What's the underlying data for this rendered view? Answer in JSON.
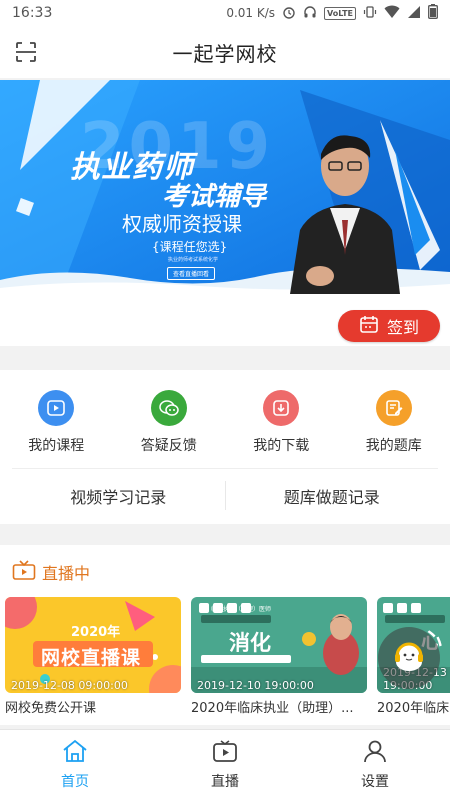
{
  "status_bar": {
    "time": "16:33",
    "speed": "0.01 K/s",
    "network_badge": "VoLTE"
  },
  "header": {
    "title": "一起学网校",
    "scan_icon": "scan-icon"
  },
  "banner": {
    "year": "2019",
    "line1": "执业药师",
    "line2": "考试辅导",
    "line3": "权威师资授课",
    "line4": "{课程任您选}",
    "line5": "执业药师考试系统化学",
    "line6": "查看直播回看"
  },
  "checkin": {
    "label": "签到",
    "color": "#e53a2e"
  },
  "quick_menu": {
    "items": [
      {
        "label": "我的课程",
        "icon": "play-icon",
        "color": "#3d8ff0"
      },
      {
        "label": "答疑反馈",
        "icon": "chat-icon",
        "color": "#3aa93c"
      },
      {
        "label": "我的下载",
        "icon": "download-icon",
        "color": "#ee6a6a"
      },
      {
        "label": "我的题库",
        "icon": "edit-icon",
        "color": "#f5a02a"
      }
    ],
    "records": [
      "视频学习记录",
      "题库做题记录"
    ]
  },
  "live": {
    "title": "直播中",
    "accent": "#e0761f",
    "cards": [
      {
        "date": "2019-12-08 09:00:00",
        "name": "网校免费公开课",
        "thumb_title": "网校直播课",
        "thumb_year": "2020年"
      },
      {
        "date": "2019-12-10 19:00:00",
        "name": "2020年临床执业（助理）...",
        "thumb_title": "消化",
        "thumb_badge": "临床执业（助理）医师"
      },
      {
        "date": "2019-12-13 19:00:00",
        "name": "2020年临床",
        "thumb_title": "心"
      }
    ]
  },
  "tabbar": {
    "tabs": [
      {
        "label": "首页",
        "icon": "home-icon",
        "active": true
      },
      {
        "label": "直播",
        "icon": "tv-icon",
        "active": false
      },
      {
        "label": "设置",
        "icon": "user-icon",
        "active": false
      }
    ],
    "active_color": "#1da1f2"
  }
}
